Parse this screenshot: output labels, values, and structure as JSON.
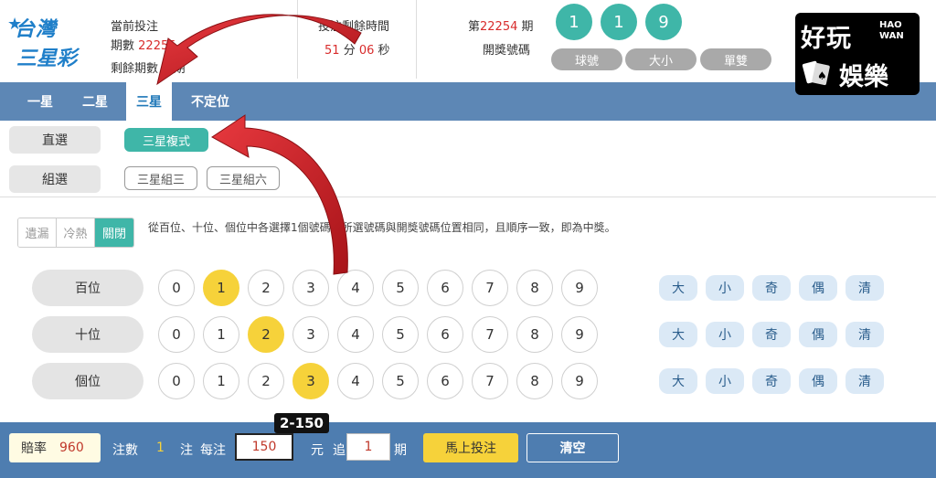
{
  "header": {
    "logo": {
      "line1": "台灣",
      "line2": "三星彩"
    },
    "current_bet_label": "當前投注",
    "period_label": "期數",
    "period_value": "22255",
    "remaining_label": "剩餘期數",
    "remaining_value": "1",
    "remaining_unit": "期",
    "countdown_label": "投注剩餘時間",
    "countdown_min": "51",
    "countdown_min_unit": "分",
    "countdown_sec": "06",
    "countdown_sec_unit": "秒",
    "draw_prefix": "第",
    "draw_number": "22254",
    "draw_suffix": "期",
    "draw_label": "開獎號碼",
    "balls": [
      "1",
      "1",
      "9"
    ],
    "result_buttons": [
      "球號",
      "大小",
      "單雙"
    ],
    "brand": {
      "line1": "好玩",
      "line2": "HAO\nWAN",
      "line3": "娛樂"
    }
  },
  "tabs": [
    "一星",
    "二星",
    "三星",
    "不定位"
  ],
  "active_tab": "三星",
  "play_types": {
    "direct_label": "直選",
    "group_label": "組選",
    "direct_options": [
      "三星複式"
    ],
    "group_options": [
      "三星組三",
      "三星組六"
    ]
  },
  "miss_toggle": [
    "遺漏",
    "冷熱",
    "關閉"
  ],
  "hint": "從百位、十位、個位中各選擇1個號碼，所選號碼與開獎號碼位置相同，且順序一致，即為中獎。",
  "rows": [
    {
      "label": "百位",
      "selected": 1
    },
    {
      "label": "十位",
      "selected": 2
    },
    {
      "label": "個位",
      "selected": 3
    }
  ],
  "digits": [
    "0",
    "1",
    "2",
    "3",
    "4",
    "5",
    "6",
    "7",
    "8",
    "9"
  ],
  "quick_picks": [
    "大",
    "小",
    "奇",
    "偶",
    "清"
  ],
  "bottom": {
    "tooltip": "2-150",
    "odds_label": "賠率",
    "odds_value": "960",
    "count_label": "注數",
    "count_value": "1",
    "count_unit": "注",
    "per_bet_label": "每注",
    "per_bet_value": "150",
    "currency_unit": "元",
    "chase_label": "追",
    "chase_value": "1",
    "period_unit": "期",
    "bet_button": "馬上投注",
    "clear_button": "清空"
  },
  "colors": {
    "teal": "#3fb6a8",
    "nav_blue": "#5d87b5",
    "selected_yellow": "#f6d23a",
    "arrow_red": "#d8252c"
  }
}
